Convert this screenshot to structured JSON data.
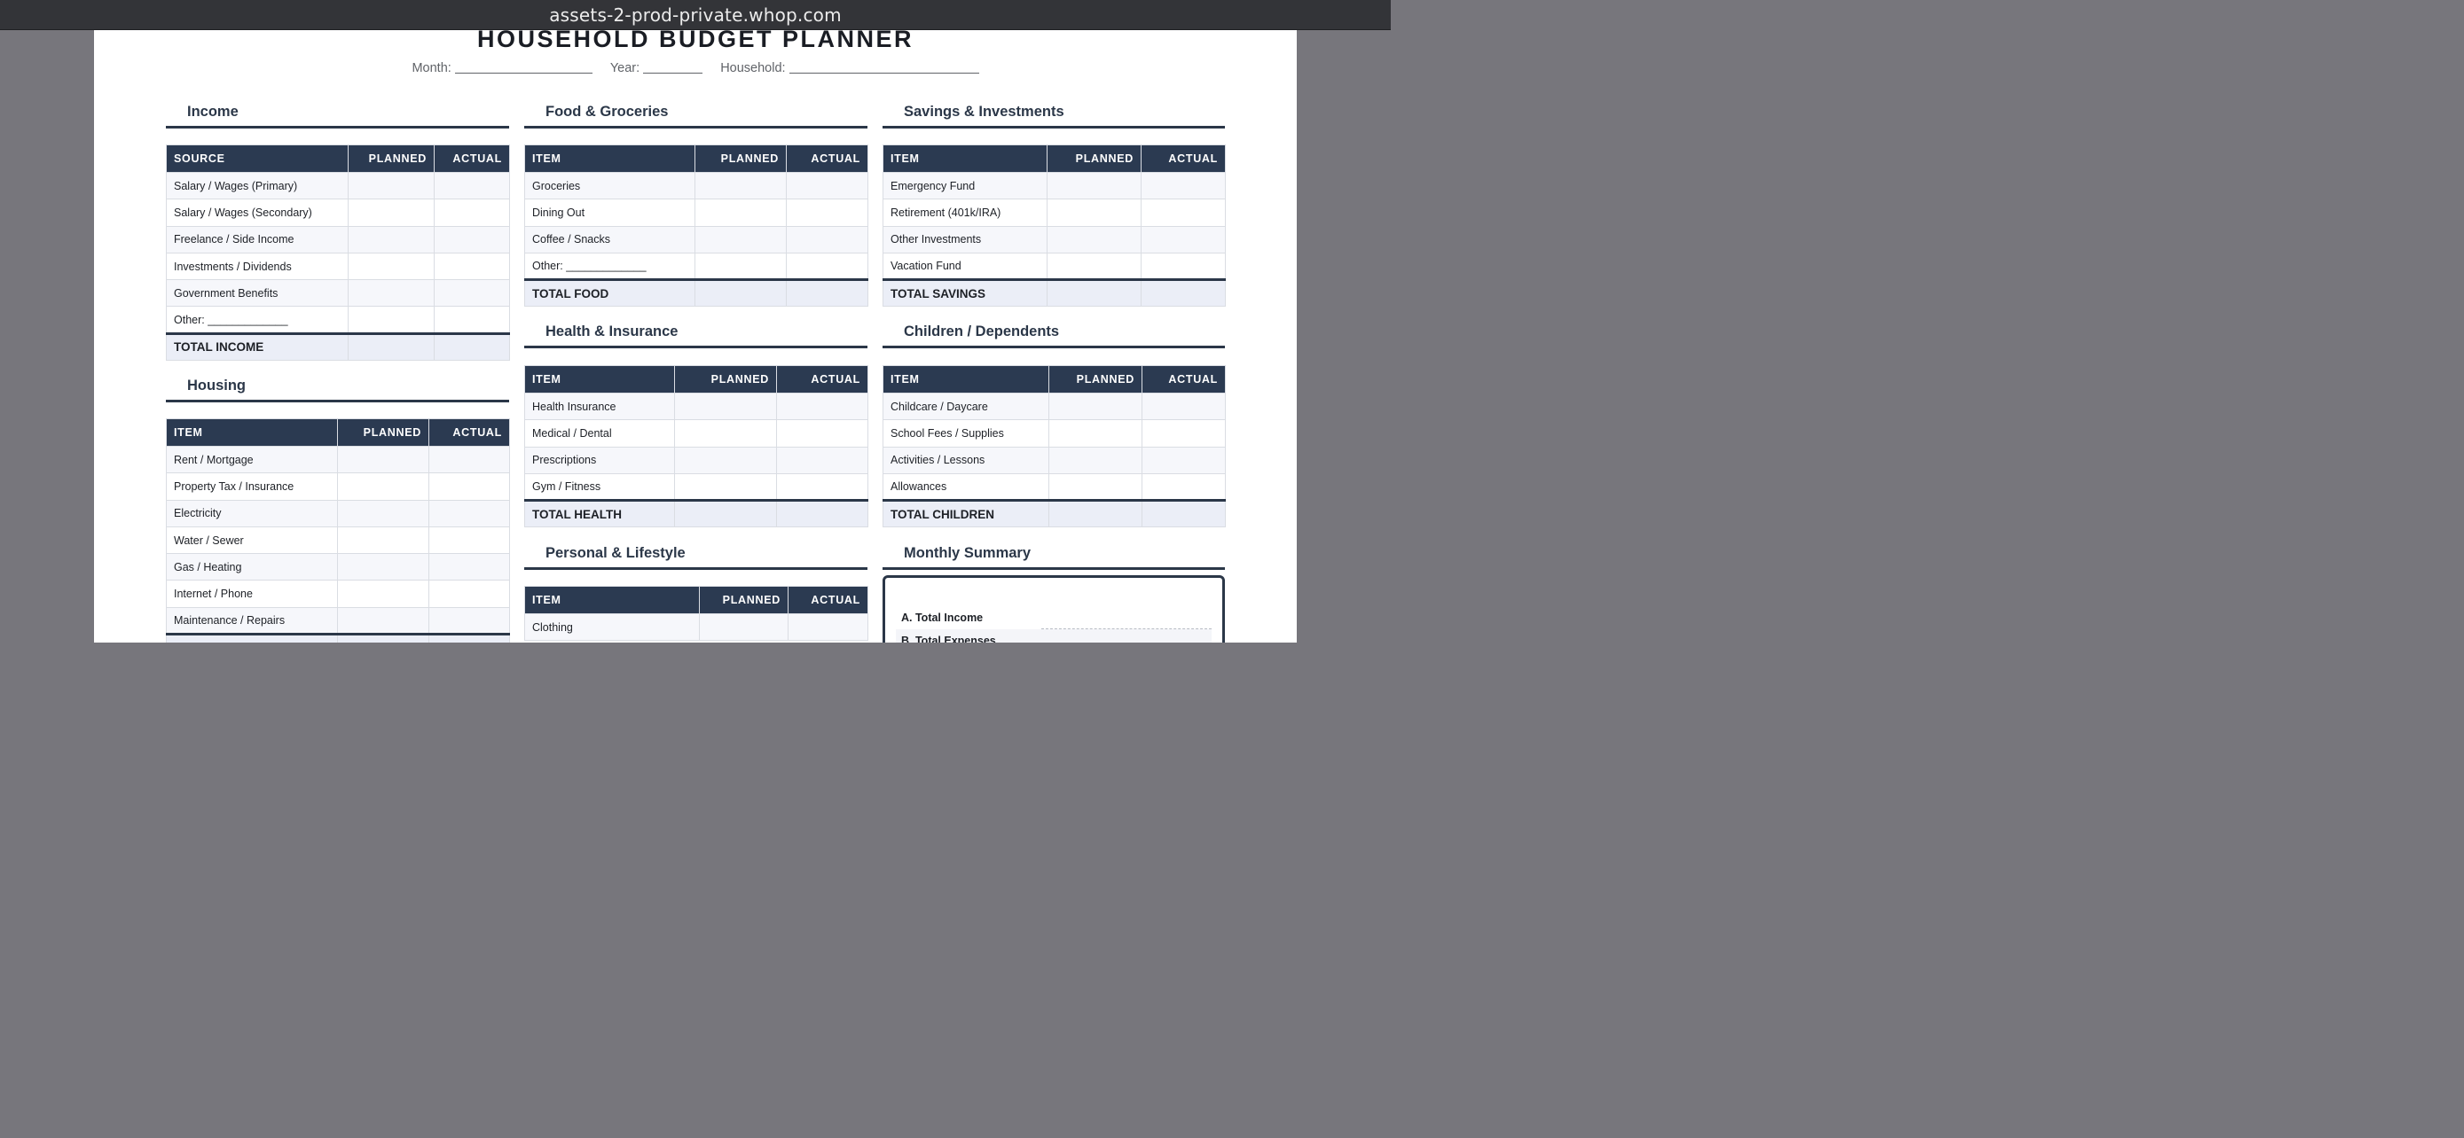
{
  "browser": {
    "url": "assets-2-prod-private.whop.com"
  },
  "page": {
    "title": "HOUSEHOLD BUDGET PLANNER",
    "month_label": "Month:",
    "year_label": "Year:",
    "household_label": "Household:"
  },
  "income": {
    "title": "Income",
    "col_source": "SOURCE",
    "col_planned": "PLANNED",
    "col_actual": "ACTUAL",
    "rows": [
      "Salary / Wages (Primary)",
      "Salary / Wages (Secondary)",
      "Freelance / Side Income",
      "Investments / Dividends",
      "Government Benefits",
      "Other: _____________"
    ],
    "total": "TOTAL INCOME"
  },
  "housing": {
    "title": "Housing",
    "col_item": "ITEM",
    "col_planned": "PLANNED",
    "col_actual": "ACTUAL",
    "rows": [
      "Rent / Mortgage",
      "Property Tax / Insurance",
      "Electricity",
      "Water / Sewer",
      "Gas / Heating",
      "Internet / Phone",
      "Maintenance / Repairs"
    ]
  },
  "food": {
    "title": "Food & Groceries",
    "col_item": "ITEM",
    "col_planned": "PLANNED",
    "col_actual": "ACTUAL",
    "rows": [
      "Groceries",
      "Dining Out",
      "Coffee / Snacks",
      "Other: _____________"
    ],
    "total": "TOTAL FOOD"
  },
  "health": {
    "title": "Health & Insurance",
    "col_item": "ITEM",
    "col_planned": "PLANNED",
    "col_actual": "ACTUAL",
    "rows": [
      "Health Insurance",
      "Medical / Dental",
      "Prescriptions",
      "Gym / Fitness"
    ],
    "total": "TOTAL HEALTH"
  },
  "personal": {
    "title": "Personal & Lifestyle",
    "col_item": "ITEM",
    "col_planned": "PLANNED",
    "col_actual": "ACTUAL",
    "rows": [
      "Clothing"
    ]
  },
  "savings": {
    "title": "Savings & Investments",
    "col_item": "ITEM",
    "col_planned": "PLANNED",
    "col_actual": "ACTUAL",
    "rows": [
      "Emergency Fund",
      "Retirement (401k/IRA)",
      "Other Investments",
      "Vacation Fund"
    ],
    "total": "TOTAL SAVINGS"
  },
  "children": {
    "title": "Children / Dependents",
    "col_item": "ITEM",
    "col_planned": "PLANNED",
    "col_actual": "ACTUAL",
    "rows": [
      "Childcare / Daycare",
      "School Fees / Supplies",
      "Activities / Lessons",
      "Allowances"
    ],
    "total": "TOTAL CHILDREN"
  },
  "summary": {
    "title": "Monthly Summary",
    "rows": [
      "A. Total Income",
      "B. Total Expenses"
    ]
  }
}
